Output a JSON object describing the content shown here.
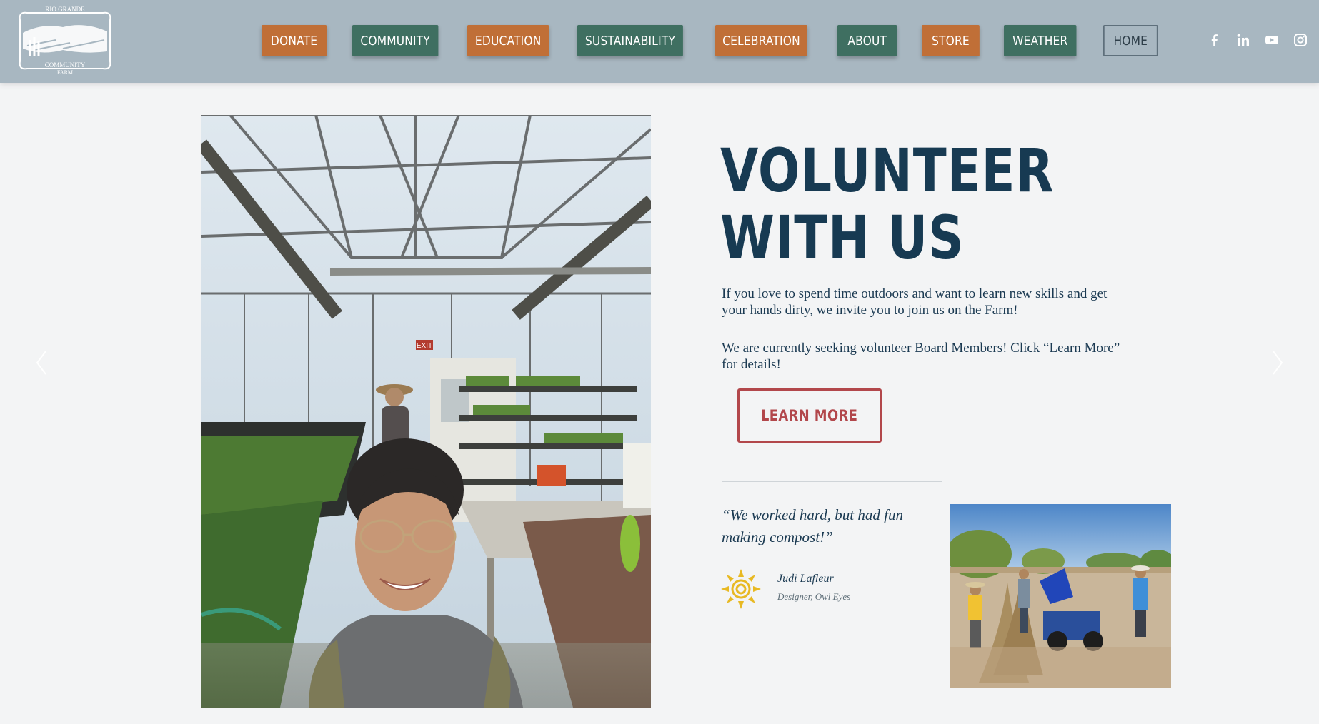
{
  "header": {
    "logo": {
      "text_top": "RIO GRANDE",
      "text_bottom_1": "COMMUNITY",
      "text_bottom_2": "FARM"
    },
    "nav": [
      {
        "label": "DONATE",
        "style": "orange"
      },
      {
        "label": "COMMUNITY",
        "style": "green"
      },
      {
        "label": "EDUCATION",
        "style": "orange"
      },
      {
        "label": "SUSTAINABILITY",
        "style": "green"
      },
      {
        "label": "CELEBRATION",
        "style": "orange"
      },
      {
        "label": "ABOUT",
        "style": "green"
      },
      {
        "label": "STORE",
        "style": "orange"
      },
      {
        "label": "WEATHER",
        "style": "green"
      },
      {
        "label": "HOME",
        "style": "home"
      }
    ],
    "social_icons": [
      "facebook-icon",
      "linkedin-icon",
      "youtube-icon",
      "instagram-icon"
    ]
  },
  "hero": {
    "title_line1": "VOLUNTEER",
    "title_line2": "WITH US",
    "paragraph1": "If you love to spend time outdoors and want to learn new skills and get your hands dirty, we invite you to join us on the Farm!",
    "paragraph2": "We are currently seeking volunteer Board Members! Click “Learn More” for details!",
    "button_label": "LEARN MORE",
    "sign_text": "EXIT"
  },
  "testimonial": {
    "quote": "“We worked hard, but had fun making compost!”",
    "author": "Judi Lafleur",
    "role": "Designer, Owl Eyes"
  },
  "colors": {
    "header_bg": "#a8b7c1",
    "orange": "#c06f37",
    "green": "#3f6f61",
    "title": "#173a52",
    "accent_red": "#b2474b",
    "sun": "#e8b923"
  }
}
